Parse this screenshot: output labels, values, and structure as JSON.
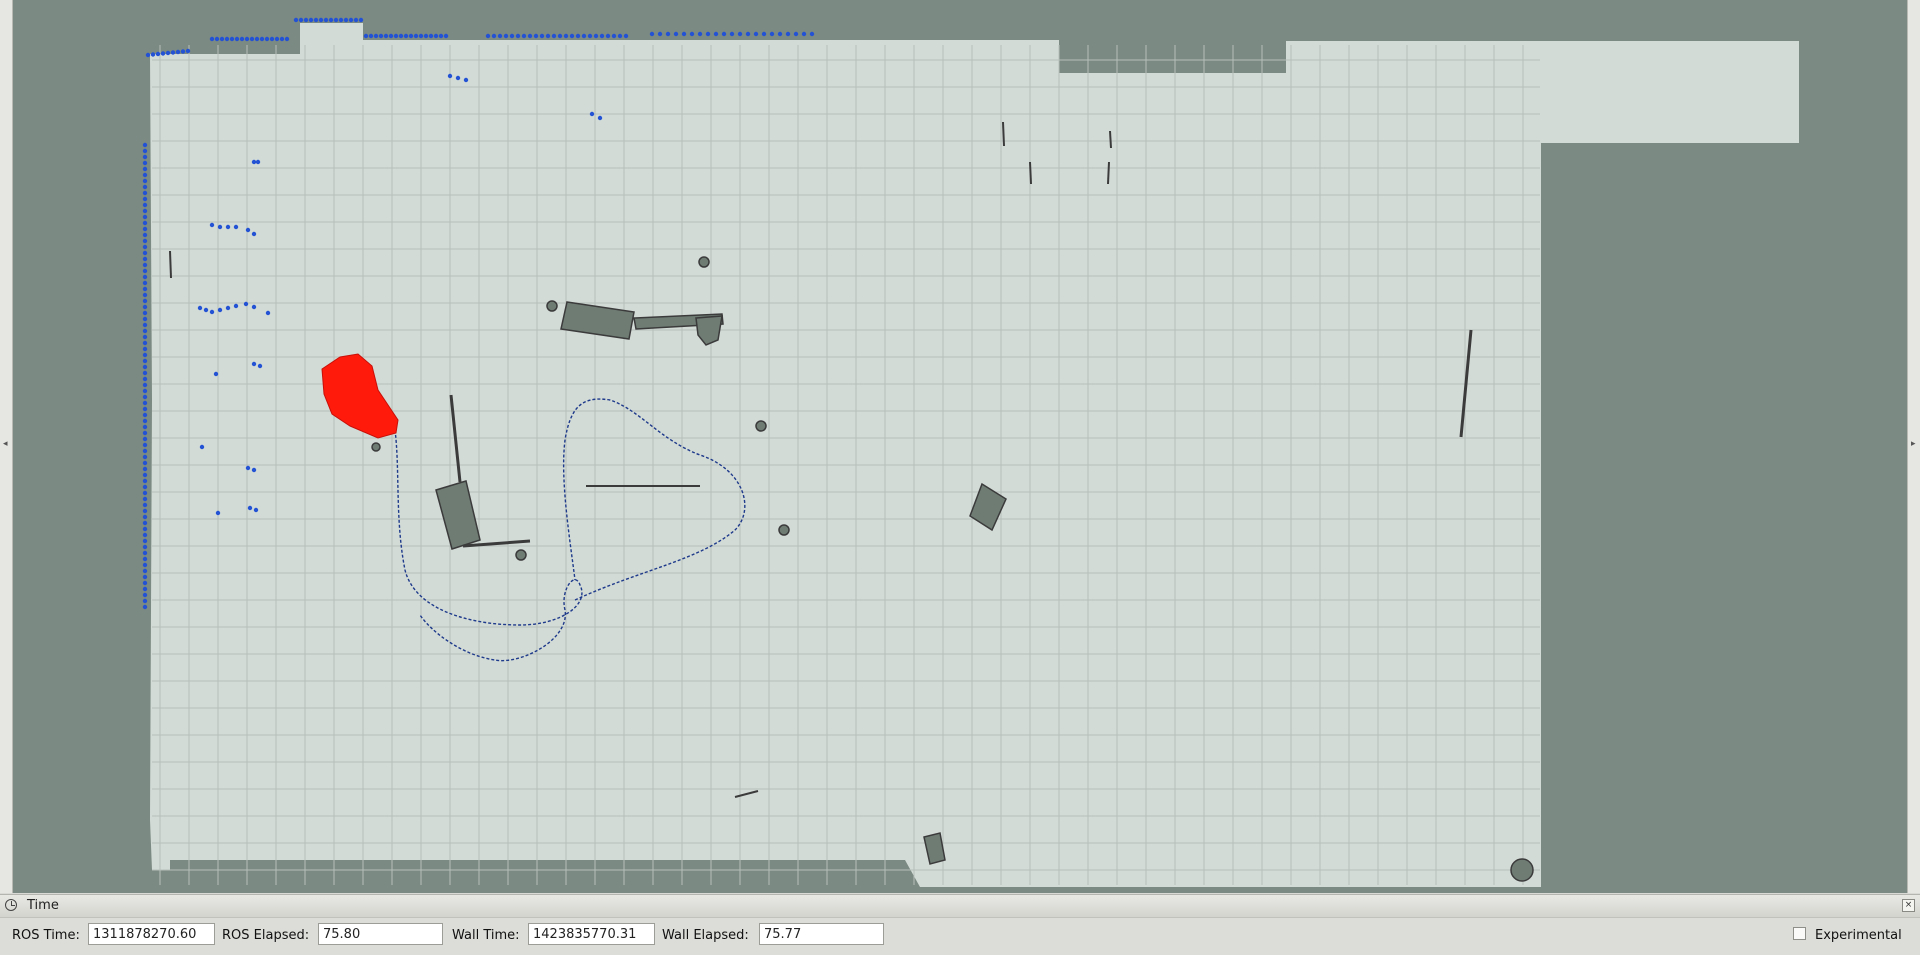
{
  "viewport": {
    "colors": {
      "unknown": "#7b8a82",
      "free": "#d3dbd7",
      "grid": "#b7bfbb",
      "obstacle": "#3b3b3b",
      "inflated": "#6e7c74",
      "laser": "#2352d4",
      "costmap": "#ff1a0c",
      "path": "#1e3a8a"
    },
    "icons": [
      "panel-left-arrow-icon",
      "panel-right-arrow-icon"
    ]
  },
  "time_panel": {
    "title": "Time",
    "close_label": "×",
    "ros_time": {
      "label": "ROS Time:",
      "value": "1311878270.60"
    },
    "ros_elapsed": {
      "label": "ROS Elapsed:",
      "value": "75.80"
    },
    "wall_time": {
      "label": "Wall Time:",
      "value": "1423835770.31"
    },
    "wall_elapsed": {
      "label": "Wall Elapsed:",
      "value": "75.77"
    },
    "experimental": {
      "label": "Experimental",
      "checked": false
    }
  }
}
